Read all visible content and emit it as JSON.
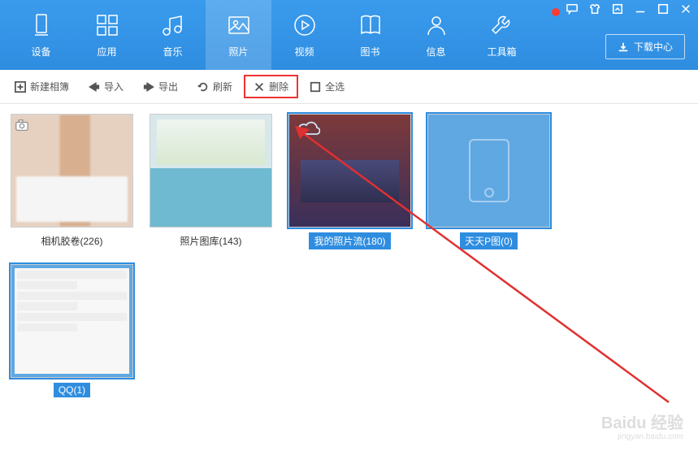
{
  "nav": [
    {
      "label": "设备",
      "icon": "device"
    },
    {
      "label": "应用",
      "icon": "apps"
    },
    {
      "label": "音乐",
      "icon": "music"
    },
    {
      "label": "照片",
      "icon": "photo",
      "active": true
    },
    {
      "label": "视频",
      "icon": "video"
    },
    {
      "label": "图书",
      "icon": "book"
    },
    {
      "label": "信息",
      "icon": "contact"
    },
    {
      "label": "工具箱",
      "icon": "tools"
    }
  ],
  "download_btn": "下载中心",
  "toolbar": [
    {
      "label": "新建相簿",
      "icon": "new"
    },
    {
      "label": "导入",
      "icon": "import"
    },
    {
      "label": "导出",
      "icon": "export"
    },
    {
      "label": "刷新",
      "icon": "refresh"
    },
    {
      "label": "删除",
      "icon": "delete",
      "highlight": true
    },
    {
      "label": "全选",
      "icon": "selectall"
    }
  ],
  "albums": [
    {
      "name": "相机胶卷",
      "count": 226,
      "kind": "camera",
      "selected": false
    },
    {
      "name": "照片图库",
      "count": 143,
      "kind": "pool",
      "selected": false
    },
    {
      "name": "我的照片流",
      "count": 180,
      "kind": "cloud",
      "selected": true
    },
    {
      "name": "天天P图",
      "count": 0,
      "kind": "phone",
      "selected": true
    },
    {
      "name": "QQ",
      "count": 1,
      "kind": "chat",
      "selected": true
    }
  ],
  "watermark": {
    "brand": "Baidu 经验",
    "url": "jingyan.baidu.com"
  },
  "colors": {
    "accent": "#2f8de0",
    "highlight": "#e33"
  }
}
